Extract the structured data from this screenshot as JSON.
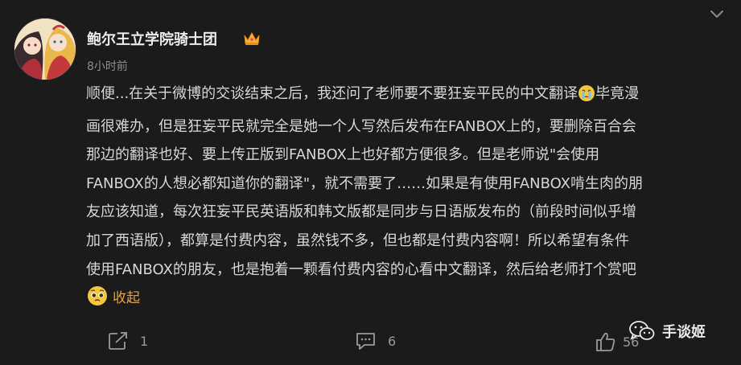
{
  "author": {
    "name": "鲍尔王立学院骑士团",
    "avatar_icon": "avatar-anime-girls",
    "badge_icon": "crown-icon"
  },
  "post": {
    "time": "8小时前",
    "lines": [
      "顺便...在关于微博的交谈结束之后，我还问了老师要不要狂妄平民的中文翻译",
      "画很难办，但是狂妄平民就完全是她一个人写然后发布在FANBOX上的，要删除百合会",
      "那边的翻译也好、要上传正版到FANBOX上也好都方便很多。但是老师说\"会使用",
      "FANBOX的人想必都知道你的翻译\"，就不需要了……如果是有使用FANBOX啃生肉的朋",
      "友应该知道，每次狂妄平民英语版和韩文版都是同步与日语版发布的（前段时间似乎增",
      "加了西语版），都算是付费内容，虽然钱不多，但也都是付费内容啊！所以希望有条件",
      "使用FANBOX的朋友，也是抱着一颗看付费内容的心看中文翻译，然后给老师打个赏吧"
    ],
    "line1_tail": "毕竟漫",
    "inline_emoji": "crying-face-emoji",
    "collapse_label": "收起",
    "collapse_emoji": "pleading-face-emoji"
  },
  "actions": {
    "repost_count": "1",
    "comment_count": "6",
    "like_count": "56"
  },
  "watermark": {
    "text": "手谈姬",
    "icon": "wechat-icon"
  },
  "colors": {
    "background": "#1b1b1b",
    "text": "#d6d6d6",
    "meta": "#8c8c8c",
    "accent": "#e6a23c"
  }
}
